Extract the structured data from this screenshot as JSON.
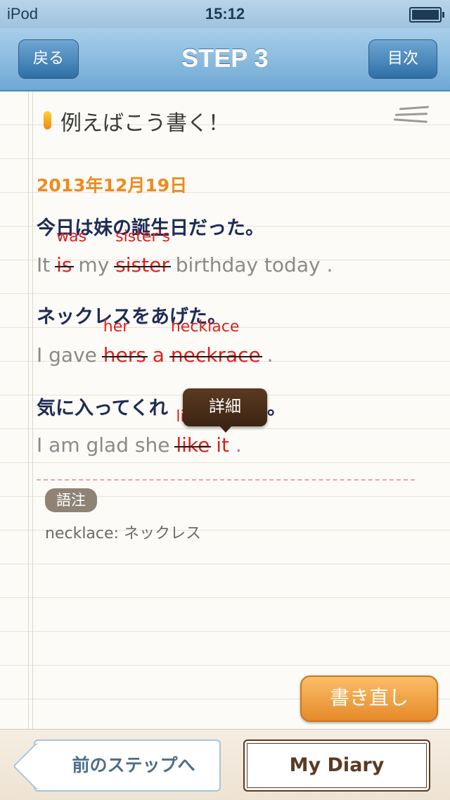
{
  "status_bar": {
    "carrier": "iPod",
    "time": "15:12"
  },
  "nav": {
    "back_label": "戻る",
    "title": "STEP 3",
    "toc_label": "目次"
  },
  "section": {
    "heading": "例えばこう書く！"
  },
  "entry": {
    "date": "2013年12月19日",
    "sentences": [
      {
        "jp": "今日は妹の誕生日だった。",
        "en": [
          {
            "t": "It ",
            "k": "plain"
          },
          {
            "t": "is",
            "k": "wrong",
            "c": "was"
          },
          {
            "t": " my ",
            "k": "plain"
          },
          {
            "t": "sister",
            "k": "wrong",
            "c": "sister's"
          },
          {
            "t": " birthday today .",
            "k": "plain"
          }
        ]
      },
      {
        "jp": "ネックレスをあげた。",
        "en": [
          {
            "t": "I gave ",
            "k": "plain"
          },
          {
            "t": "hers",
            "k": "wrong",
            "c": "her"
          },
          {
            "t": " ",
            "k": "plain"
          },
          {
            "t": "a",
            "k": "red"
          },
          {
            "t": " ",
            "k": "plain"
          },
          {
            "t": "neckrace",
            "k": "wrong",
            "c": "necklace"
          },
          {
            "t": " .",
            "k": "plain"
          }
        ]
      },
      {
        "jp": "気に入ってくれ",
        "jp_end": "た。",
        "en": [
          {
            "t": "I am glad she ",
            "k": "plain"
          },
          {
            "t": "like",
            "k": "wrong",
            "c": "liked"
          },
          {
            "t": " ",
            "k": "plain"
          },
          {
            "t": "it",
            "k": "red"
          },
          {
            "t": " .",
            "k": "plain"
          }
        ]
      }
    ],
    "tooltip": "詳細"
  },
  "notes": {
    "badge": "語注",
    "text": "necklace: ネックレス"
  },
  "actions": {
    "rewrite": "書き直し"
  },
  "bottom": {
    "prev_label": "前のステップへ",
    "diary_label": "My Diary"
  },
  "colors": {
    "accent_orange": "#f08a1e",
    "correction_red": "#e0201c",
    "nav_blue": "#6ea8d4"
  }
}
